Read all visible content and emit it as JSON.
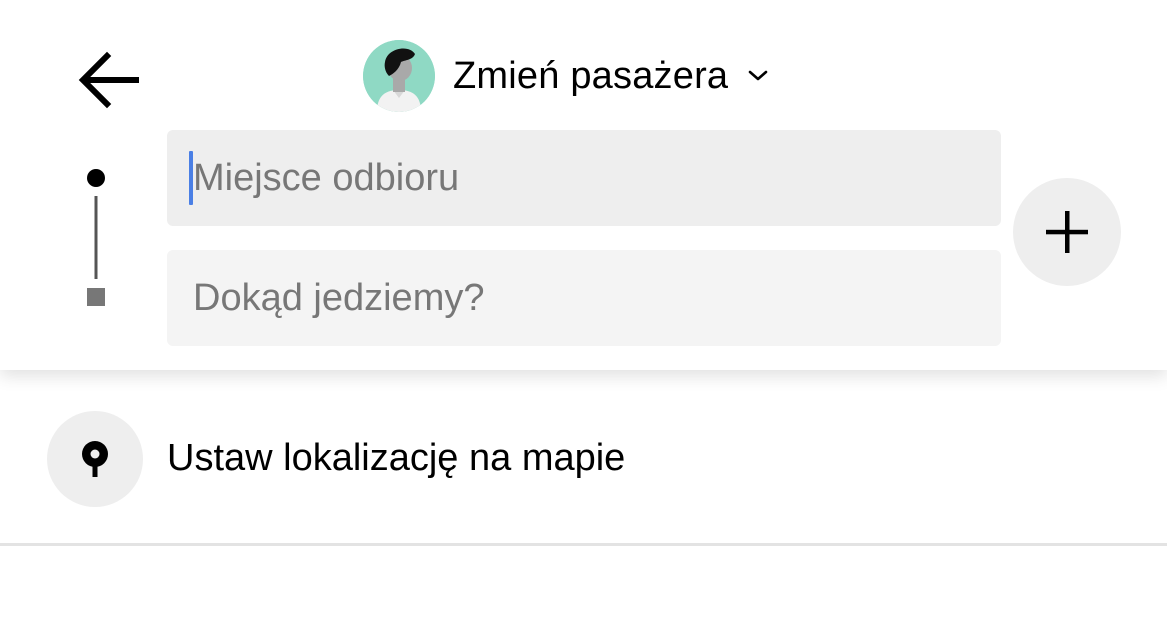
{
  "header": {
    "back_icon": "arrow-left-icon",
    "rider_switch": {
      "label": "Zmień pasażera",
      "avatar_icon": "person-avatar-icon",
      "dropdown_icon": "chevron-down-icon",
      "avatar_color": "#8fd9c4"
    }
  },
  "trip": {
    "pickup": {
      "value": "",
      "placeholder": "Miejsce odbioru"
    },
    "destination": {
      "value": "",
      "placeholder": "Dokąd jedziemy?"
    },
    "route_icons": {
      "start": "dot-icon",
      "end": "square-icon"
    },
    "add_stop_icon": "plus-icon"
  },
  "suggestions": [
    {
      "label": "Ustaw lokalizację na mapie",
      "icon": "map-pin-icon"
    }
  ],
  "colors": {
    "caret": "#4a7fe5",
    "field_bg": "#eeeeee",
    "placeholder": "#777777"
  }
}
